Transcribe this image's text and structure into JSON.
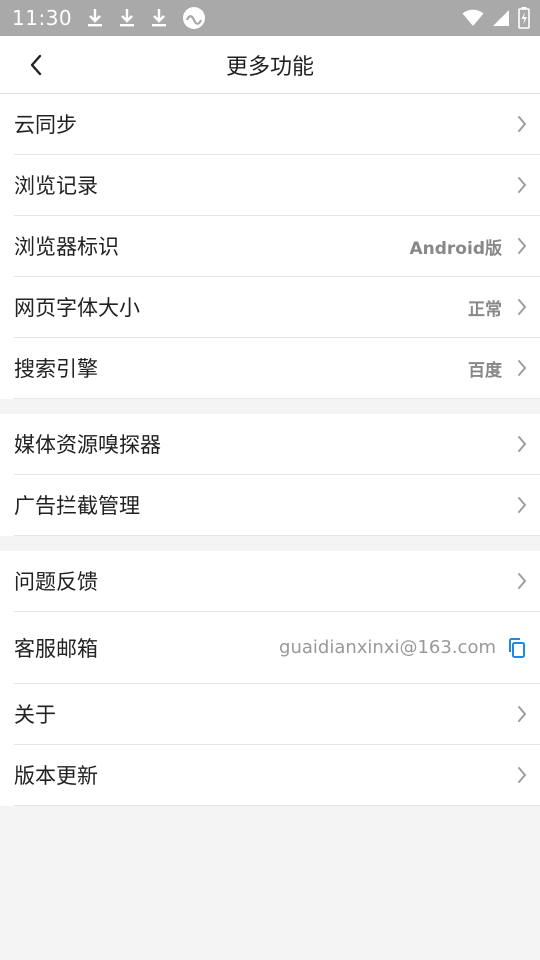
{
  "status_bar": {
    "time": "11:30",
    "icons": [
      "download-icon",
      "download-icon",
      "download-icon",
      "infinity-app-icon",
      "wifi-icon",
      "signal-icon",
      "battery-icon"
    ]
  },
  "header": {
    "title": "更多功能",
    "back_icon": "chevron-left-icon"
  },
  "groups": [
    {
      "items": [
        {
          "label": "云同步",
          "value": ""
        },
        {
          "label": "浏览记录",
          "value": ""
        },
        {
          "label": "浏览器标识",
          "value": "Android版"
        },
        {
          "label": "网页字体大小",
          "value": "正常"
        },
        {
          "label": "搜索引擎",
          "value": "百度"
        }
      ]
    },
    {
      "items": [
        {
          "label": "媒体资源嗅探器",
          "value": ""
        },
        {
          "label": "广告拦截管理",
          "value": ""
        }
      ]
    },
    {
      "items": [
        {
          "label": "问题反馈",
          "value": ""
        },
        {
          "label": "客服邮箱",
          "value": "guaidianxinxi@163.com"
        },
        {
          "label": "关于",
          "value": ""
        },
        {
          "label": "版本更新",
          "value": ""
        }
      ]
    }
  ],
  "colors": {
    "status_bar": "#a9a9a9",
    "accent_copy": "#1e88e5",
    "chevron": "#9e9e9e",
    "background": "#f4f4f4"
  }
}
